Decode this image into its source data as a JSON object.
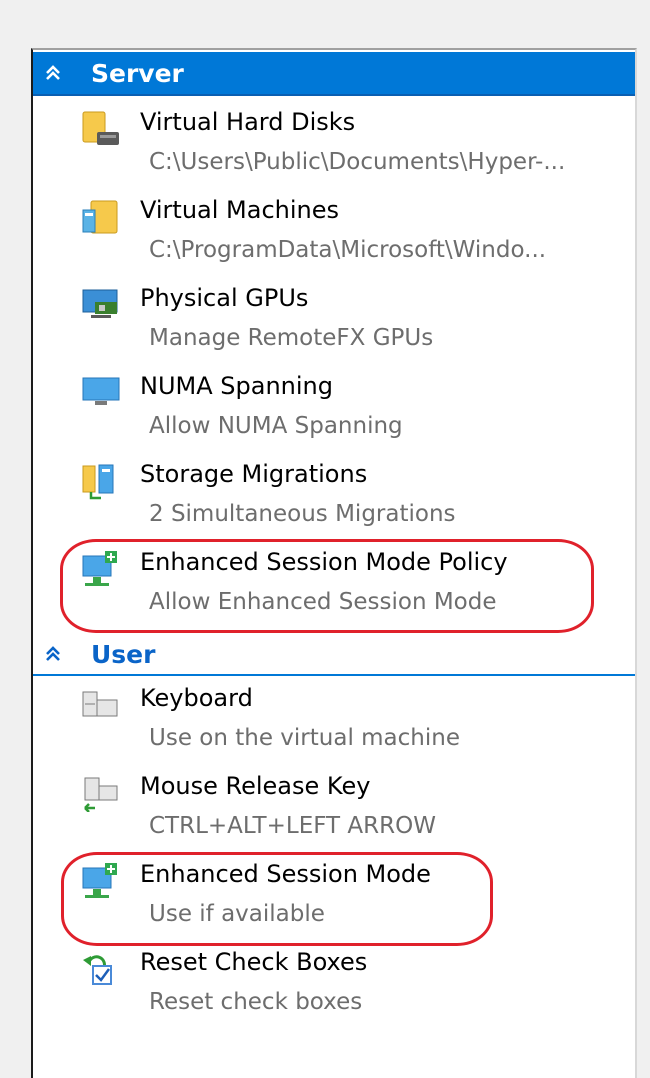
{
  "sections": {
    "server": {
      "title": "Server",
      "items": [
        {
          "title": "Virtual Hard Disks",
          "subtitle": "C:\\Users\\Public\\Documents\\Hyper-...",
          "icon": "hard-disk-folder-icon"
        },
        {
          "title": "Virtual Machines",
          "subtitle": "C:\\ProgramData\\Microsoft\\Windo...",
          "icon": "virtual-machine-folder-icon"
        },
        {
          "title": "Physical GPUs",
          "subtitle": "Manage RemoteFX GPUs",
          "icon": "gpu-icon"
        },
        {
          "title": "NUMA Spanning",
          "subtitle": "Allow NUMA Spanning",
          "icon": "monitor-icon"
        },
        {
          "title": "Storage Migrations",
          "subtitle": "2 Simultaneous Migrations",
          "icon": "storage-migration-icon"
        },
        {
          "title": "Enhanced Session Mode Policy",
          "subtitle": "Allow Enhanced Session Mode",
          "icon": "enhanced-session-icon"
        }
      ]
    },
    "user": {
      "title": "User",
      "items": [
        {
          "title": "Keyboard",
          "subtitle": "Use on the virtual machine",
          "icon": "keyboard-icon"
        },
        {
          "title": "Mouse Release Key",
          "subtitle": "CTRL+ALT+LEFT ARROW",
          "icon": "mouse-release-key-icon"
        },
        {
          "title": "Enhanced Session Mode",
          "subtitle": "Use if available",
          "icon": "enhanced-session-icon"
        },
        {
          "title": "Reset Check Boxes",
          "subtitle": "Reset check boxes",
          "icon": "reset-checkbox-icon"
        }
      ]
    }
  },
  "colors": {
    "header_blue": "#0078d7",
    "highlight_red": "#e0212b",
    "subtitle_gray": "#6d6d6d"
  }
}
